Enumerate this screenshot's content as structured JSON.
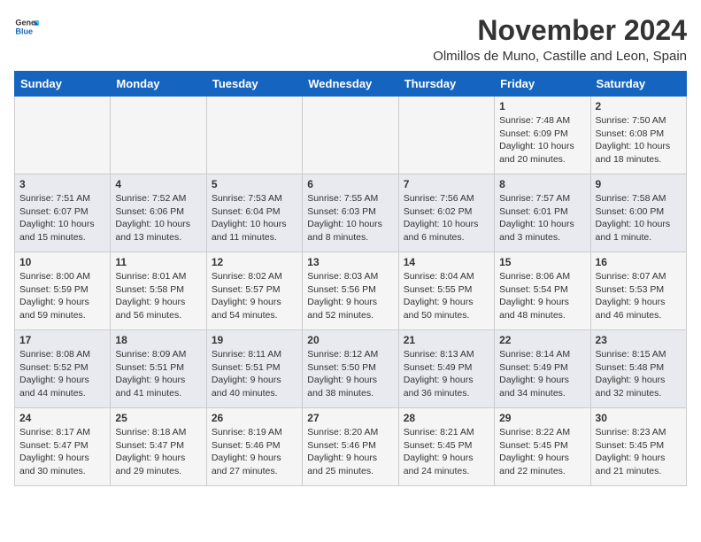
{
  "header": {
    "logo_general": "General",
    "logo_blue": "Blue",
    "month_year": "November 2024",
    "location": "Olmillos de Muno, Castille and Leon, Spain"
  },
  "days_of_week": [
    "Sunday",
    "Monday",
    "Tuesday",
    "Wednesday",
    "Thursday",
    "Friday",
    "Saturday"
  ],
  "weeks": [
    [
      {
        "day": "",
        "info": ""
      },
      {
        "day": "",
        "info": ""
      },
      {
        "day": "",
        "info": ""
      },
      {
        "day": "",
        "info": ""
      },
      {
        "day": "",
        "info": ""
      },
      {
        "day": "1",
        "info": "Sunrise: 7:48 AM\nSunset: 6:09 PM\nDaylight: 10 hours and 20 minutes."
      },
      {
        "day": "2",
        "info": "Sunrise: 7:50 AM\nSunset: 6:08 PM\nDaylight: 10 hours and 18 minutes."
      }
    ],
    [
      {
        "day": "3",
        "info": "Sunrise: 7:51 AM\nSunset: 6:07 PM\nDaylight: 10 hours and 15 minutes."
      },
      {
        "day": "4",
        "info": "Sunrise: 7:52 AM\nSunset: 6:06 PM\nDaylight: 10 hours and 13 minutes."
      },
      {
        "day": "5",
        "info": "Sunrise: 7:53 AM\nSunset: 6:04 PM\nDaylight: 10 hours and 11 minutes."
      },
      {
        "day": "6",
        "info": "Sunrise: 7:55 AM\nSunset: 6:03 PM\nDaylight: 10 hours and 8 minutes."
      },
      {
        "day": "7",
        "info": "Sunrise: 7:56 AM\nSunset: 6:02 PM\nDaylight: 10 hours and 6 minutes."
      },
      {
        "day": "8",
        "info": "Sunrise: 7:57 AM\nSunset: 6:01 PM\nDaylight: 10 hours and 3 minutes."
      },
      {
        "day": "9",
        "info": "Sunrise: 7:58 AM\nSunset: 6:00 PM\nDaylight: 10 hours and 1 minute."
      }
    ],
    [
      {
        "day": "10",
        "info": "Sunrise: 8:00 AM\nSunset: 5:59 PM\nDaylight: 9 hours and 59 minutes."
      },
      {
        "day": "11",
        "info": "Sunrise: 8:01 AM\nSunset: 5:58 PM\nDaylight: 9 hours and 56 minutes."
      },
      {
        "day": "12",
        "info": "Sunrise: 8:02 AM\nSunset: 5:57 PM\nDaylight: 9 hours and 54 minutes."
      },
      {
        "day": "13",
        "info": "Sunrise: 8:03 AM\nSunset: 5:56 PM\nDaylight: 9 hours and 52 minutes."
      },
      {
        "day": "14",
        "info": "Sunrise: 8:04 AM\nSunset: 5:55 PM\nDaylight: 9 hours and 50 minutes."
      },
      {
        "day": "15",
        "info": "Sunrise: 8:06 AM\nSunset: 5:54 PM\nDaylight: 9 hours and 48 minutes."
      },
      {
        "day": "16",
        "info": "Sunrise: 8:07 AM\nSunset: 5:53 PM\nDaylight: 9 hours and 46 minutes."
      }
    ],
    [
      {
        "day": "17",
        "info": "Sunrise: 8:08 AM\nSunset: 5:52 PM\nDaylight: 9 hours and 44 minutes."
      },
      {
        "day": "18",
        "info": "Sunrise: 8:09 AM\nSunset: 5:51 PM\nDaylight: 9 hours and 41 minutes."
      },
      {
        "day": "19",
        "info": "Sunrise: 8:11 AM\nSunset: 5:51 PM\nDaylight: 9 hours and 40 minutes."
      },
      {
        "day": "20",
        "info": "Sunrise: 8:12 AM\nSunset: 5:50 PM\nDaylight: 9 hours and 38 minutes."
      },
      {
        "day": "21",
        "info": "Sunrise: 8:13 AM\nSunset: 5:49 PM\nDaylight: 9 hours and 36 minutes."
      },
      {
        "day": "22",
        "info": "Sunrise: 8:14 AM\nSunset: 5:49 PM\nDaylight: 9 hours and 34 minutes."
      },
      {
        "day": "23",
        "info": "Sunrise: 8:15 AM\nSunset: 5:48 PM\nDaylight: 9 hours and 32 minutes."
      }
    ],
    [
      {
        "day": "24",
        "info": "Sunrise: 8:17 AM\nSunset: 5:47 PM\nDaylight: 9 hours and 30 minutes."
      },
      {
        "day": "25",
        "info": "Sunrise: 8:18 AM\nSunset: 5:47 PM\nDaylight: 9 hours and 29 minutes."
      },
      {
        "day": "26",
        "info": "Sunrise: 8:19 AM\nSunset: 5:46 PM\nDaylight: 9 hours and 27 minutes."
      },
      {
        "day": "27",
        "info": "Sunrise: 8:20 AM\nSunset: 5:46 PM\nDaylight: 9 hours and 25 minutes."
      },
      {
        "day": "28",
        "info": "Sunrise: 8:21 AM\nSunset: 5:45 PM\nDaylight: 9 hours and 24 minutes."
      },
      {
        "day": "29",
        "info": "Sunrise: 8:22 AM\nSunset: 5:45 PM\nDaylight: 9 hours and 22 minutes."
      },
      {
        "day": "30",
        "info": "Sunrise: 8:23 AM\nSunset: 5:45 PM\nDaylight: 9 hours and 21 minutes."
      }
    ]
  ]
}
